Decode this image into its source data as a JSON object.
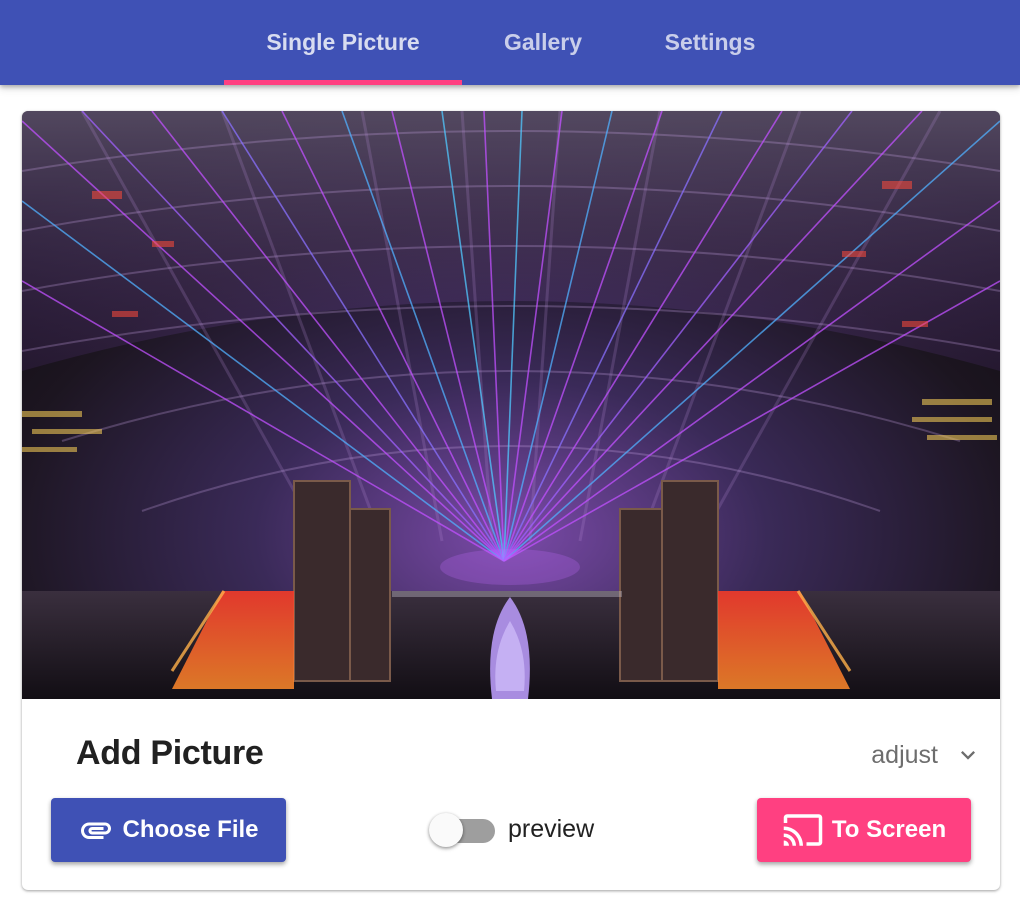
{
  "tabs": [
    {
      "label": "Single Picture",
      "active": true
    },
    {
      "label": "Gallery",
      "active": false
    },
    {
      "label": "Settings",
      "active": false
    }
  ],
  "colors": {
    "primary": "#3f51b5",
    "accent": "#ff4081"
  },
  "card": {
    "title": "Add Picture",
    "adjust": {
      "label": "adjust",
      "icon": "chevron-down-icon"
    },
    "choose_button": {
      "label": "Choose File",
      "icon": "paperclip-icon"
    },
    "preview_toggle": {
      "label": "preview",
      "checked": false
    },
    "screen_button": {
      "label": "To Screen",
      "icon": "cast-icon"
    }
  }
}
